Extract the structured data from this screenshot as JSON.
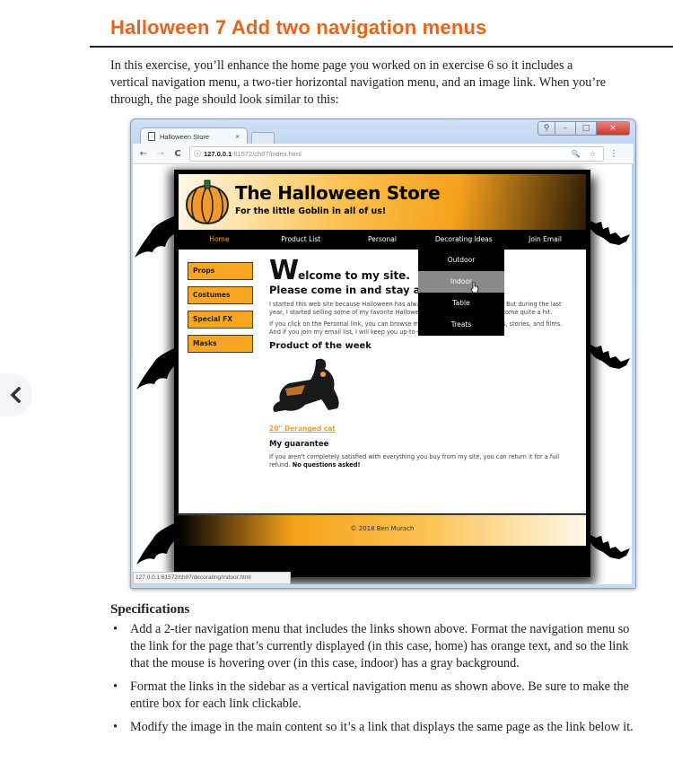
{
  "document": {
    "title": "Halloween 7 Add two navigation menus",
    "intro": "In this exercise, you’ll enhance the home page you worked on in exercise 6 so it includes a vertical navigation menu, a two-tier horizontal navigation menu, and an image link. When you’re through, the page should look similar to this:",
    "back_button_glyph": "‹"
  },
  "browser": {
    "tab_title": "Halloween Store",
    "tab_close": "×",
    "url_host": "127.0.0.1",
    "url_path": ":61572/ch07/index.html",
    "status_url": "127.0.0.1:61572/ch07/decorating/indoor.html",
    "controls": {
      "minimize": "–",
      "maximize": "□",
      "close": "×",
      "user": "⚲"
    },
    "icons": {
      "back": "←",
      "forward": "→",
      "reload": "C",
      "info": "ⓘ",
      "search_star": "🔍 ☆",
      "menu": "⋮"
    }
  },
  "site": {
    "title": "The Halloween Store",
    "subtitle": "For the little Goblin in all of us!",
    "nav": [
      {
        "label": "Home",
        "current": true
      },
      {
        "label": "Product List"
      },
      {
        "label": "Personal"
      },
      {
        "label": "Decorating Ideas"
      },
      {
        "label": "Join Email"
      }
    ],
    "submenu": [
      {
        "label": "Outdoor"
      },
      {
        "label": "Indoor",
        "hover": true
      },
      {
        "label": "Table"
      },
      {
        "label": "Treats"
      }
    ],
    "sidebar": [
      {
        "label": "Props"
      },
      {
        "label": "Costumes"
      },
      {
        "label": "Special FX"
      },
      {
        "label": "Masks"
      }
    ],
    "main": {
      "welcome_big": "W",
      "welcome_rest": "elcome to my site.",
      "please": "Please come in and stay awhile.",
      "p1": "I started this web site because Halloween has always been my favorite holiday. But during the last year, I started selling some of my favorite Halloween products, and they've become quite a hit.",
      "p2": "If you click on the Personal link, you can browse my favorite Halloween pictures, stories, and films. And if you join my email list, I will keep you up-to-date on all things Halloween.",
      "product_heading": "Product of the week",
      "product_link": "20\" Deranged cat",
      "guarantee_heading": "My guarantee",
      "guarantee_text": "If you aren't completely satisfied with everything you buy from my site, you can return it for a full refund. ",
      "guarantee_bold": "No questions asked!"
    },
    "footer": "© 2018 Ben Murach",
    "colors": {
      "orange": "#f6a623",
      "nav_current": "#f2a02e",
      "hover_gray": "#8a8a8a",
      "title_orange": "#e8641c"
    }
  },
  "specifications": {
    "title": "Specifications",
    "items": [
      "Add a 2-tier navigation menu that includes the links shown above. Format the navigation menu so the link for the page that’s currently displayed (in this case, home) has orange text, and so the link that the mouse is hovering over (in this case, indoor) has a gray background.",
      "Format the links in the sidebar as a vertical navigation menu as shown above. Be sure to make the entire box for each link clickable.",
      "Modify the image in the main content so it’s a link that displays the same page as the link below it."
    ],
    "bullet": "•"
  }
}
